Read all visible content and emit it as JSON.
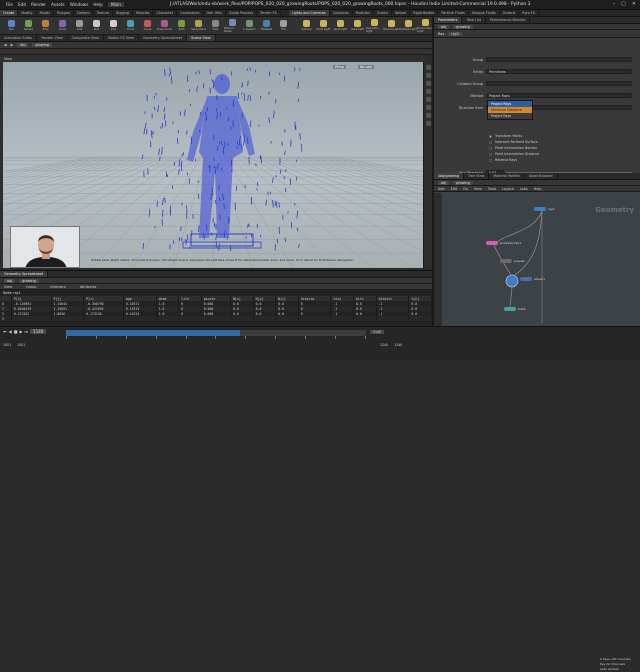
{
  "titlebar": {
    "menus": [
      "File",
      "Edit",
      "Render",
      "Assets",
      "Windows",
      "Help"
    ],
    "desktop": "Main",
    "title": "J:/ATLAS/Work/edu-sb/work_files/POP/POPS_020_020_growingRoots/POPS_020_020_growingRoots_000.hipnc - Houdini Indie Limited-Commercial 19.0.498 - Python 3",
    "build": "Main",
    "win_controls": [
      "–",
      "▢",
      "✕"
    ]
  },
  "shelf": {
    "tabs": [
      "Create",
      "Modify",
      "Model",
      "Polygon",
      "Deform",
      "Texture",
      "Rigging",
      "Muscles",
      "Character",
      "Constraints",
      "Hair Utils",
      "Guide Process",
      "Terrain FX",
      "Simple FX",
      "Volume"
    ],
    "tabs_right": [
      "Lights and Cameras",
      "Collisions",
      "Particles",
      "Grains",
      "Vellum",
      "Rigid Bodies",
      "Particle Fluids",
      "Viscous Fluids",
      "Oceans",
      "Pyro FX",
      "FEM",
      "Wires",
      "Crowds",
      "Drive Simulation"
    ],
    "tools": [
      {
        "label": "Box",
        "color": "#5b87c4"
      },
      {
        "label": "Sphere",
        "color": "#6fa05a"
      },
      {
        "label": "Tube",
        "color": "#b8823d"
      },
      {
        "label": "Torus",
        "color": "#8a63b0"
      },
      {
        "label": "Grid",
        "color": "#9a9a9a"
      },
      {
        "label": "Null",
        "color": "#c9c9c9"
      },
      {
        "label": "Line",
        "color": "#d0d0d0"
      },
      {
        "label": "Circle",
        "color": "#4d9fb8"
      },
      {
        "label": "Curve",
        "color": "#c55a5a"
      },
      {
        "label": "Draw Curve",
        "color": "#a65c8f"
      },
      {
        "label": "Path",
        "color": "#7a9b3e"
      },
      {
        "label": "Spray Paint",
        "color": "#b0a24c"
      },
      {
        "label": "Font",
        "color": "#888"
      },
      {
        "label": "Platonic Solids",
        "color": "#6f8fb0"
      },
      {
        "label": "L-System",
        "color": "#6d9a6d"
      },
      {
        "label": "Metaball",
        "color": "#4f7db5"
      },
      {
        "label": "File",
        "color": "#a0a0a0"
      }
    ],
    "light_tools": [
      "Camera",
      "Point Light",
      "Spot Light",
      "Area Light",
      "Geometry Light",
      "Volume Light",
      "Distant Light",
      "Environment Light",
      "Sky Light",
      "GI Light",
      "Caustic Light",
      "Portal Light",
      "Ambient Light",
      "Stereo Camera",
      "VR Camera",
      "Switcher",
      "Gamepad Camera"
    ]
  },
  "viewer": {
    "tabs": [
      "Animation Editor",
      "Render View",
      "Composite View",
      "Motion FX View",
      "Geometry Spreadsheet",
      "Scene View"
    ],
    "active_tab": "Scene View",
    "path_obj": "obj",
    "path_node": "growing",
    "toolbar_label": "View",
    "persp_label": "Persp",
    "cam_label": "No cam",
    "status_hint": "Middle pans. Right dollies. Ctrl+Left tool pans. Ctrl+Right zooms. Spacebar Ctrl-Left tiles. Press H for alternate tumble, dolly, and zoom.    M or Alt+M for First Person Navigation."
  },
  "spreadsheet": {
    "tabs": [
      "Geometry Spreadsheet"
    ],
    "path_obj": "obj",
    "path_node": "growing",
    "view_label": "View",
    "group_label": "Group",
    "intrinsic_label": "Intrinsics",
    "attributes_label": "Attributes",
    "node_label": "Node: ray1",
    "columns": [
      "",
      "P[x]",
      "P[y]",
      "P[z]",
      "age",
      "dead",
      "life",
      "pscale",
      "N[x]",
      "N[y]",
      "N[z]",
      "hitprim",
      "hitu",
      "hitv",
      "hitdist",
      "v[x]"
    ],
    "rows": [
      [
        "0",
        "-0.126961",
        "1.14644",
        "-0.306796",
        "0.10371",
        "1.0",
        "0",
        "0.000",
        "0.0",
        "0.0",
        "0.0",
        "0",
        "-1",
        "0.0",
        "-1",
        "0.0"
      ],
      [
        "1",
        "0.0404419",
        "1.15091",
        "-0.422694",
        "0.15315",
        "1.0",
        "0",
        "0.000",
        "0.0",
        "0.0",
        "0.0",
        "0",
        "-1",
        "0.0",
        "-1",
        "0.0"
      ],
      [
        "2",
        "0.212262",
        "1.8036",
        "0.173146",
        "0.14224",
        "1.0",
        "0",
        "0.000",
        "0.0",
        "0.0",
        "0.0",
        "0",
        "-1",
        "0.0",
        "-1",
        "0.0"
      ],
      [
        "3",
        "",
        "",
        "",
        "",
        "",
        "",
        "",
        "",
        "",
        "",
        "",
        "",
        "",
        "",
        ""
      ]
    ]
  },
  "timeline": {
    "current_frame": "1140",
    "start": "1001",
    "end": "1240",
    "range_start": "1001",
    "range_end": "1240",
    "frame_display": "1140",
    "right_keys": "0 keys, 0/0 channels",
    "right_key_all": "Key All Channels",
    "auto_update": "Auto Update",
    "fill_fraction": 0.58,
    "ticks": [
      "1001",
      "1024",
      "1048",
      "1072",
      "1096",
      "1120",
      "1144",
      "1168",
      "1192",
      "1216",
      "1240"
    ]
  },
  "parameters": {
    "tabs": [
      "Parameters",
      "Take List",
      "Performance Monitor"
    ],
    "path_obj": "obj",
    "path_node": "growing",
    "node_type": "Ray",
    "node_name": "ray1",
    "rows": [
      {
        "label": "Group",
        "value": ""
      },
      {
        "label": "Entity",
        "value": "Primitives"
      },
      {
        "label": "Collision Group",
        "value": ""
      },
      {
        "label": "Method",
        "value": "Project Rays"
      },
      {
        "label": "Direction from",
        "value": "Vector"
      }
    ],
    "dropdown_options": [
      "Project Rays",
      "Minimum Distance",
      "Project Rays"
    ],
    "dropdown_selected": "Minimum Distance",
    "checks": [
      {
        "label": "Transform Points",
        "on": true
      },
      {
        "label": "Intersect Farthest Surface",
        "on": false
      },
      {
        "label": "Point Intersection Normal",
        "on": false
      },
      {
        "label": "Point Intersection Distance",
        "on": false
      },
      {
        "label": "Reverse Rays",
        "on": false
      }
    ],
    "ray_tolerance_label": "Ray Tolerance",
    "ray_tolerance_value": "0.01"
  },
  "network": {
    "tabs": [
      "/obj/growing",
      "Tree View",
      "Material Palette",
      "Asset Browser"
    ],
    "path_obj": "obj",
    "path_node": "growing",
    "menu": [
      "Add",
      "Edit",
      "Go",
      "View",
      "Tools",
      "Layout",
      "Labs",
      "Help"
    ],
    "watermark": "Geometry",
    "nodes": [
      {
        "label": "ray1",
        "color": "#3f7cc7"
      },
      {
        "label": "pointvelocity1",
        "color": "#d35fb0"
      },
      {
        "label": "popnet",
        "color": "#6a6a6a"
      },
      {
        "label": "solver1",
        "color": "#4a6fa0"
      },
      {
        "label": "trail1",
        "color": "#4aa0a0"
      }
    ]
  },
  "colors": {
    "accent": "#d8862c",
    "selection": "#2d5fa0",
    "timeline_fill": "#2f6aa6",
    "viewport_points": "#2b3ec8"
  }
}
